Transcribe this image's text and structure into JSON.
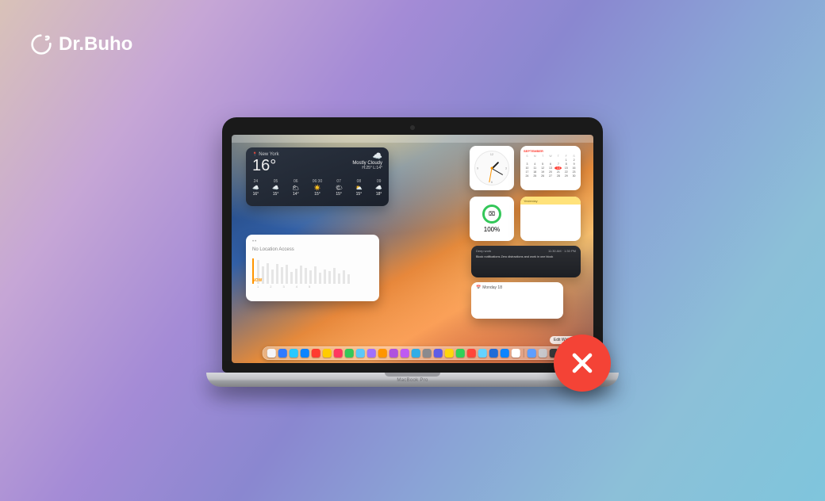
{
  "brand": {
    "name": "Dr.Buho"
  },
  "device": {
    "label": "MacBook Pro"
  },
  "edit_widgets_label": "Edit Widgets",
  "weather": {
    "location": "New York",
    "temp": "16°",
    "summary": "Mostly Cloudy",
    "hilo": "H:25° L:14°",
    "hours": [
      {
        "t": "24",
        "ic": "☁️",
        "v": "16°"
      },
      {
        "t": "05",
        "ic": "☁️",
        "v": "15°"
      },
      {
        "t": "06",
        "ic": "🌥",
        "v": "14°"
      },
      {
        "t": "06:30",
        "ic": "☀️",
        "v": "15°"
      },
      {
        "t": "07",
        "ic": "🌤",
        "v": "15°"
      },
      {
        "t": "08",
        "ic": "⛅",
        "v": "15°"
      },
      {
        "t": "09",
        "ic": "☁️",
        "v": "18°"
      }
    ]
  },
  "screentime": {
    "title": "No Location Access",
    "now_label": "NOW",
    "bars": [
      30,
      22,
      26,
      18,
      25,
      21,
      24,
      15,
      19,
      23,
      20,
      17,
      22,
      14,
      18,
      16,
      20,
      13,
      17,
      12
    ],
    "ticks": [
      "1",
      "2",
      "3",
      "4",
      "5"
    ]
  },
  "clock": {
    "numerals": {
      "n12": "12",
      "n3": "3",
      "n6": "6",
      "n9": "9"
    }
  },
  "calendar": {
    "month": "SEPTEMBER",
    "dow": [
      "S",
      "M",
      "T",
      "W",
      "T",
      "F",
      "S"
    ],
    "days": [
      "",
      "",
      "",
      "",
      "",
      "1",
      "2",
      "3",
      "4",
      "5",
      "6",
      "7",
      "8",
      "9",
      "10",
      "11",
      "12",
      "13",
      "14",
      "15",
      "16",
      "17",
      "18",
      "19",
      "20",
      "21",
      "22",
      "23",
      "24",
      "25",
      "26",
      "27",
      "28",
      "29",
      "30",
      ""
    ],
    "today_index": 18
  },
  "battery": {
    "icon_text": "⌧",
    "pct": "100%"
  },
  "card_a": {
    "header": "Yesterday"
  },
  "card_dark": {
    "line1_left": "Deep work",
    "line1_right": "11:30 AM · 1:30 PM",
    "line2": "Block notifications Zero distractions and work in one block"
  },
  "card_b": {
    "title": "Monday 18"
  },
  "dock_colors": [
    "#f5f5f7",
    "#2f7bff",
    "#29c8ff",
    "#0b84ff",
    "#ff3b30",
    "#ffcc00",
    "#ff375f",
    "#34c759",
    "#5ac8fa",
    "#A070FF",
    "#ff9500",
    "#af52de",
    "#bf5af2",
    "#32ade6",
    "#8a8a8e",
    "#5e5ce6",
    "#ffd60a",
    "#30d158",
    "#ff453a",
    "#64d2ff",
    "#1f6bd6",
    "#0a84ff",
    "#ffffff",
    "#5e9eff",
    "#c9c9cd",
    "#3a3a3c"
  ]
}
